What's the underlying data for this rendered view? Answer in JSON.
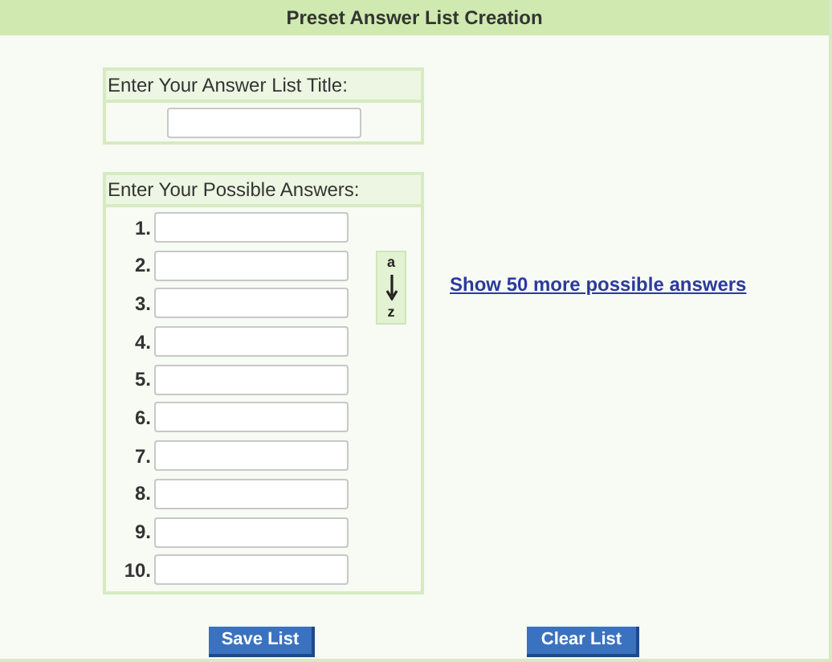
{
  "header": {
    "title": "Preset Answer List Creation"
  },
  "title_box": {
    "label": "Enter Your Answer List Title:"
  },
  "answers_box": {
    "label": "Enter Your Possible Answers:",
    "rows": [
      {
        "number": "1."
      },
      {
        "number": "2."
      },
      {
        "number": "3."
      },
      {
        "number": "4."
      },
      {
        "number": "5."
      },
      {
        "number": "6."
      },
      {
        "number": "7."
      },
      {
        "number": "8."
      },
      {
        "number": "9."
      },
      {
        "number": "10."
      }
    ],
    "sort_button": {
      "top": "a",
      "bottom": "z"
    }
  },
  "more_link": "Show 50 more possible answers",
  "buttons": [
    "Save List",
    "Clear List"
  ]
}
